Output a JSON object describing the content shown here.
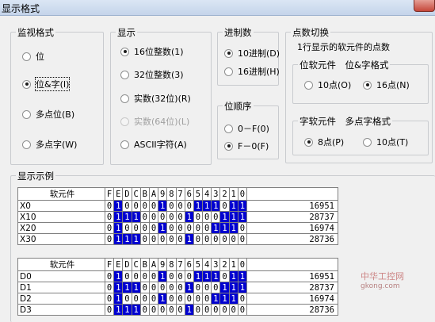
{
  "window": {
    "title": "显示格式"
  },
  "monitor": {
    "legend": "监视格式",
    "options": [
      "位",
      "位&字(I)",
      "多点位(B)",
      "多点字(W)"
    ],
    "selected": 1
  },
  "display": {
    "legend": "显示",
    "options": [
      "16位整数(1)",
      "32位整数(3)",
      "实数(32位)(R)",
      "实数(64位)(L)",
      "ASCII字符(A)"
    ],
    "selected": 0,
    "disabled": 3
  },
  "radix": {
    "legend": "进制数",
    "options": [
      "10进制(D)",
      "16进制(H)"
    ],
    "selected": 0
  },
  "order": {
    "legend": "位顺序",
    "options": [
      "0－F(0)",
      "F－0(F)"
    ],
    "selected": 1
  },
  "points": {
    "legend": "点数切换",
    "note": "1行显示的软元件的点数",
    "bit_group": {
      "legend": "位软元件　位&字格式",
      "options": [
        "10点(O)",
        "16点(N)"
      ],
      "selected": 1
    },
    "word_group": {
      "legend": "字软元件　多点字格式",
      "options": [
        "8点(P)",
        "10点(T)"
      ],
      "selected": 0
    }
  },
  "example": {
    "legend": "显示示例",
    "bit_headers": [
      "F",
      "E",
      "D",
      "C",
      "B",
      "A",
      "9",
      "8",
      "7",
      "6",
      "5",
      "4",
      "3",
      "2",
      "1",
      "0"
    ],
    "table1": {
      "name_header": "软元件",
      "rows": [
        {
          "name": "X0",
          "bits": "0100001000111011",
          "value": "16951"
        },
        {
          "name": "X10",
          "bits": "0111000001000111",
          "value": "28737"
        },
        {
          "name": "X20",
          "bits": "0100001000001110",
          "value": "16974"
        },
        {
          "name": "X30",
          "bits": "0111000001000000",
          "value": "28736"
        }
      ]
    },
    "table2": {
      "name_header": "软元件",
      "rows": [
        {
          "name": "D0",
          "bits": "0100001000111011",
          "value": "16951"
        },
        {
          "name": "D1",
          "bits": "0111000001000111",
          "value": "28737"
        },
        {
          "name": "D2",
          "bits": "0100001000001110",
          "value": "16974"
        },
        {
          "name": "D3",
          "bits": "0111000001000000",
          "value": "28736"
        }
      ]
    }
  },
  "watermark": {
    "text": "中华工控网",
    "sub": "gkong.com"
  }
}
